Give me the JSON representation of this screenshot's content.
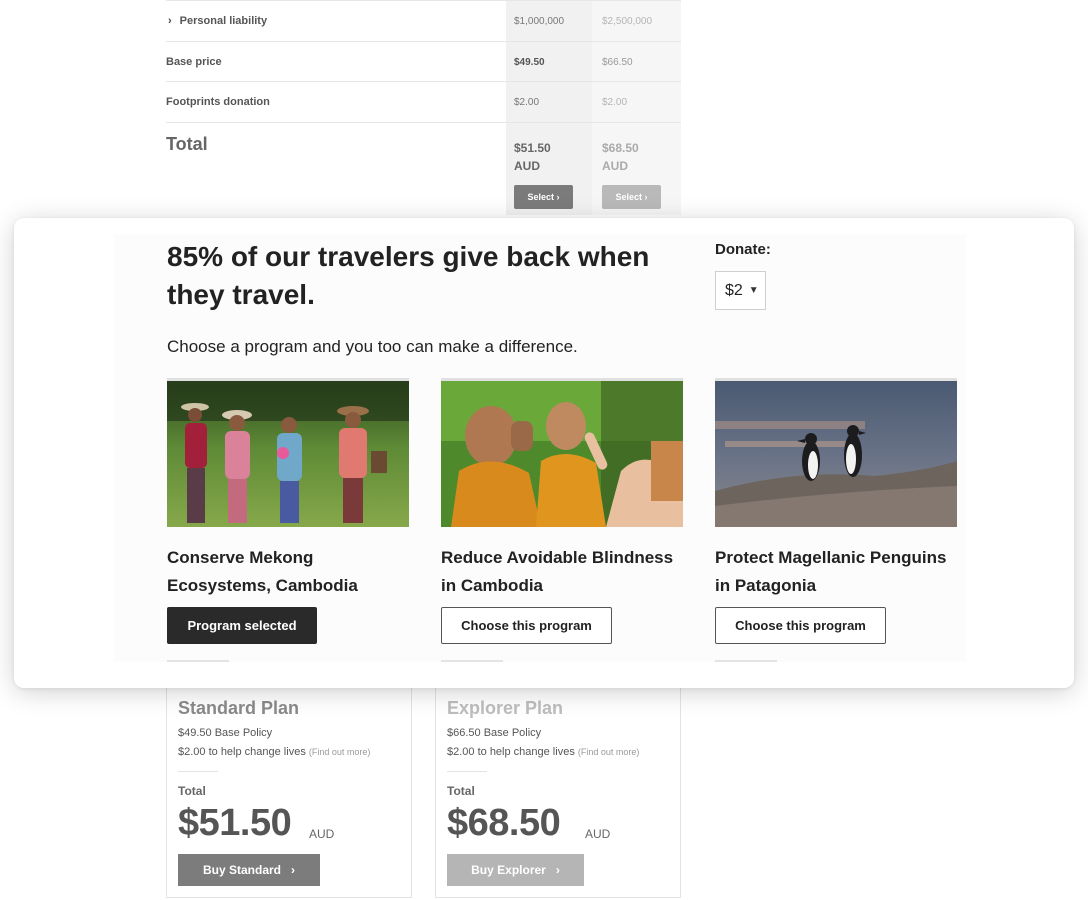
{
  "comparison": {
    "rows": [
      {
        "label": "Personal liability",
        "standard": "$1,000,000",
        "explorer": "$2,500,000"
      },
      {
        "label": "Base price",
        "standard": "$49.50",
        "explorer": "$66.50"
      },
      {
        "label": "Footprints donation",
        "standard": "$2.00",
        "explorer": "$2.00"
      }
    ],
    "total_label": "Total",
    "total_standard": "$51.50 AUD",
    "total_explorer": "$68.50 AUD",
    "select_label": "Select"
  },
  "modal": {
    "headline": "85% of our travelers give back when they travel.",
    "donate_label": "Donate:",
    "donate_value": "$2",
    "subheading": "Choose a program and you too can make a difference.",
    "programs": [
      {
        "title": "Conserve Mekong Ecosystems, Cambodia",
        "button": "Program selected",
        "selected": true
      },
      {
        "title": "Reduce Avoidable Blindness in Cambodia",
        "button": "Choose this program",
        "selected": false
      },
      {
        "title": "Protect Magellanic Penguins in Patagonia",
        "button": "Choose this program",
        "selected": false
      }
    ]
  },
  "plans": [
    {
      "name": "Standard Plan",
      "base": "$49.50 Base Policy",
      "donation": "$2.00 to help change lives",
      "find_out": "(Find out more)",
      "total_label": "Total",
      "amount": "$51.50",
      "currency": "AUD",
      "buy": "Buy Standard"
    },
    {
      "name": "Explorer Plan",
      "base": "$66.50 Base Policy",
      "donation": "$2.00 to help change lives",
      "find_out": "(Find out more)",
      "total_label": "Total",
      "amount": "$68.50",
      "currency": "AUD",
      "buy": "Buy Explorer"
    }
  ],
  "colors": {
    "primary_button": "#2a2a2a",
    "standard_buy": "#7c7c7c",
    "explorer_buy": "#b5b5b5"
  }
}
